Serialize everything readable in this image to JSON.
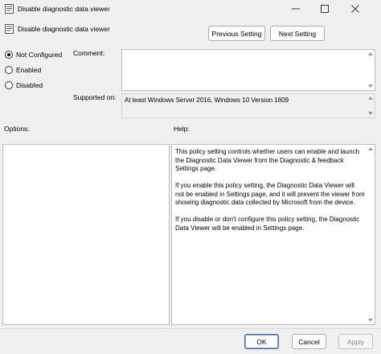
{
  "window": {
    "title": "Disable diagnostic data viewer",
    "icons": {
      "app": "policy-settings-icon",
      "minimize": "minimize-icon",
      "maximize": "maximize-icon",
      "close": "close-icon"
    }
  },
  "header": {
    "policy_name": "Disable diagnostic data viewer",
    "previous_label": "Previous Setting",
    "next_label": "Next Setting"
  },
  "state": {
    "options": [
      {
        "label": "Not Configured",
        "selected": true
      },
      {
        "label": "Enabled",
        "selected": false
      },
      {
        "label": "Disabled",
        "selected": false
      }
    ]
  },
  "comment": {
    "label": "Comment:",
    "value": ""
  },
  "supported": {
    "label": "Supported on:",
    "value": "At least Windows Server 2016, Windows 10 Version 1809"
  },
  "options_panel": {
    "label": "Options:"
  },
  "help_panel": {
    "label": "Help:",
    "paragraphs": [
      "This policy setting controls whether users can enable and launch the Diagnostic Data Viewer from the Diagnostic & feedback Settings page.",
      "If you enable this policy setting, the Diagnostic Data Viewer will not be enabled in Settings page, and it will prevent the viewer from showing diagnostic data collected by Microsoft from the device.",
      "If you disable or don't configure this policy setting, the Diagnostic Data Viewer will be enabled in Settings page."
    ]
  },
  "footer": {
    "ok_label": "OK",
    "cancel_label": "Cancel",
    "apply_label": "Apply"
  },
  "colors": {
    "background": "#f0f0f0",
    "primary_border": "#4a6fa5",
    "disabled_text": "#8a8a8a"
  }
}
